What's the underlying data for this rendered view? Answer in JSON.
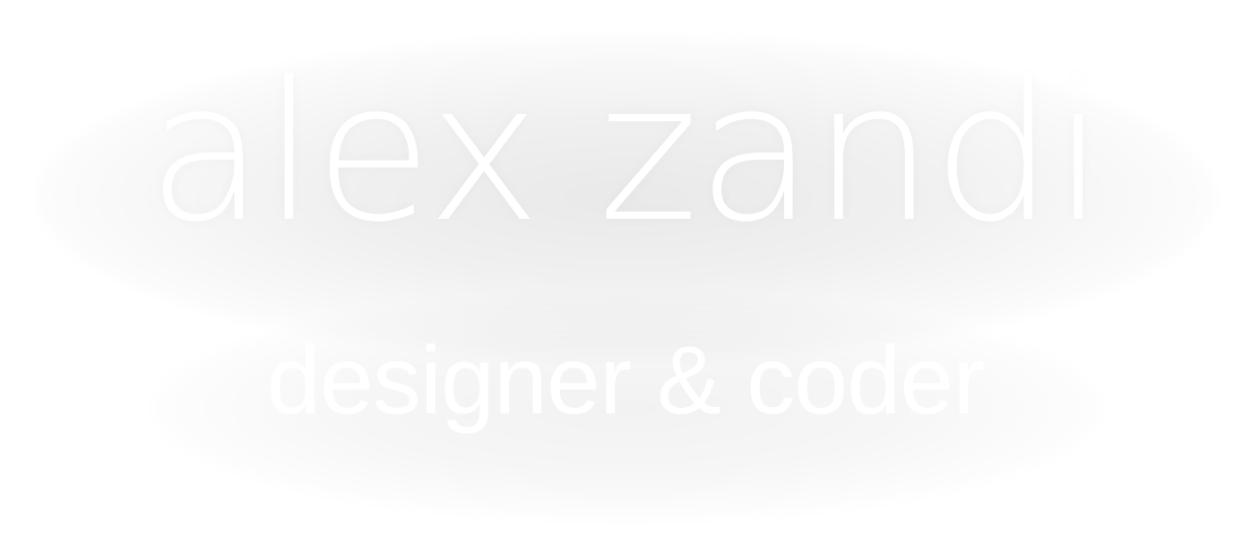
{
  "hero": {
    "name": "alex zandi",
    "tagline": "designer & coder"
  },
  "colors": {
    "background": "#ffffff",
    "text": "#ffffff",
    "glow": "#e9e9e9"
  }
}
